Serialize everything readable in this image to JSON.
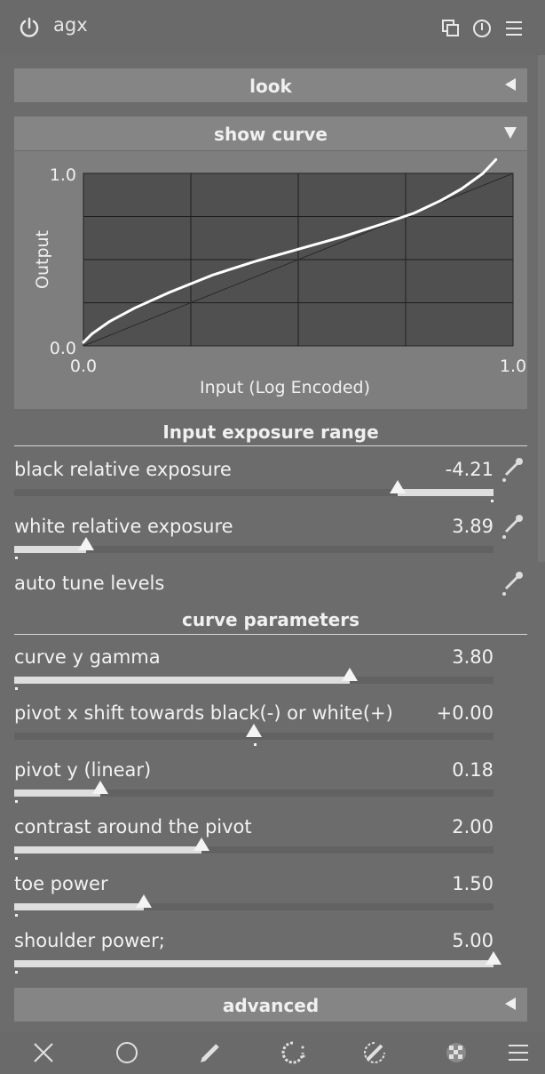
{
  "module": {
    "title": "agx",
    "header_icons": [
      "power-icon",
      "multi-instance-icon",
      "reset-icon",
      "presets-menu-icon"
    ]
  },
  "sections": {
    "look": "look",
    "show_curve": "show curve",
    "advanced": "advanced",
    "input_exposure_range": "Input exposure range",
    "curve_parameters": "curve parameters"
  },
  "chart_data": {
    "type": "line",
    "xlabel": "Input (Log Encoded)",
    "ylabel": "Output",
    "x_ticks": [
      "0.0",
      "1.0"
    ],
    "y_ticks": [
      "0.0",
      "1.0"
    ],
    "xlim": [
      0,
      1
    ],
    "ylim": [
      0,
      1
    ],
    "grid": true,
    "series": [
      {
        "x": [
          0.0,
          0.02,
          0.06,
          0.12,
          0.2,
          0.3,
          0.4,
          0.5,
          0.6,
          0.7,
          0.77,
          0.83,
          0.88,
          0.93,
          0.96
        ],
        "y": [
          0.02,
          0.07,
          0.14,
          0.22,
          0.31,
          0.41,
          0.49,
          0.56,
          0.63,
          0.71,
          0.77,
          0.84,
          0.91,
          1.0,
          1.08
        ]
      },
      {
        "x": [
          0.0,
          1.0
        ],
        "y": [
          0.0,
          1.0
        ]
      }
    ]
  },
  "sliders": [
    {
      "label": "black relative exposure",
      "value": "-4.21",
      "fraction": 0.8,
      "fill_from": "right",
      "picker": true
    },
    {
      "label": "white relative exposure",
      "value": "3.89",
      "fraction": 0.15,
      "fill_from": "left",
      "picker": true
    },
    {
      "label": "curve y gamma",
      "value": "3.80",
      "fraction": 0.7,
      "fill_from": "left",
      "picker": false
    },
    {
      "label": "pivot x shift towards black(-) or white(+)",
      "value": "+0.00",
      "fraction": 0.5,
      "fill_from": "center",
      "picker": false
    },
    {
      "label": "pivot y (linear)",
      "value": "0.18",
      "fraction": 0.18,
      "fill_from": "left",
      "picker": false
    },
    {
      "label": "contrast around the pivot",
      "value": "2.00",
      "fraction": 0.39,
      "fill_from": "left",
      "picker": false
    },
    {
      "label": "toe power",
      "value": "1.50",
      "fraction": 0.27,
      "fill_from": "left",
      "picker": false
    },
    {
      "label": "shoulder power;",
      "value": "5.00",
      "fraction": 1.0,
      "fill_from": "left",
      "picker": false
    }
  ],
  "auto_tune": {
    "label": "auto tune levels",
    "picker": true
  },
  "footer_icons": [
    "close-icon",
    "circle-mask-icon",
    "drawn-mask-icon",
    "parametric-mask-icon",
    "drawn-parametric-mask-icon",
    "raster-mask-icon",
    "blend-options-icon"
  ]
}
